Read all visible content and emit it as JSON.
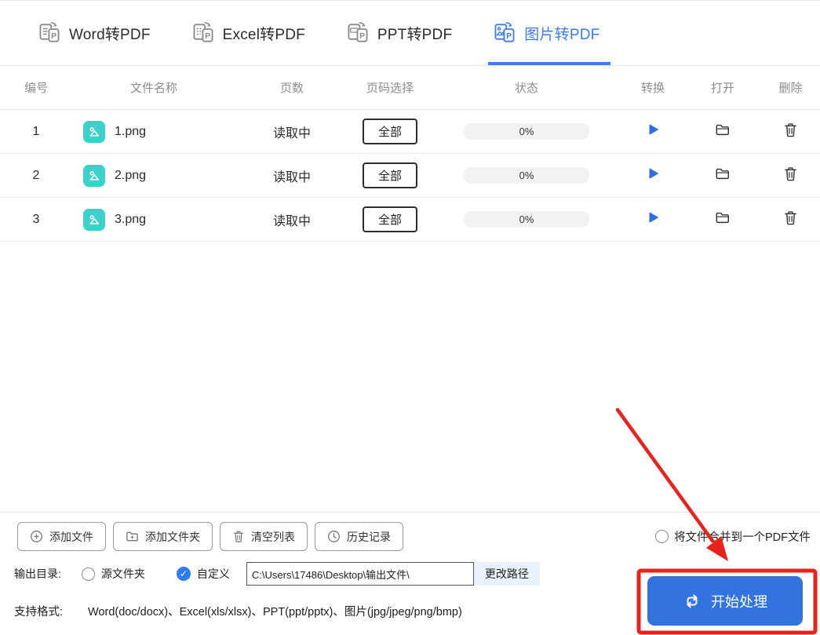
{
  "tabs": [
    {
      "label": "Word转PDF",
      "active": false
    },
    {
      "label": "Excel转PDF",
      "active": false
    },
    {
      "label": "PPT转PDF",
      "active": false
    },
    {
      "label": "图片转PDF",
      "active": true
    }
  ],
  "table": {
    "headers": [
      "编号",
      "文件名称",
      "页数",
      "页码选择",
      "状态",
      "转换",
      "打开",
      "删除"
    ],
    "rows": [
      {
        "index": "1",
        "filename": "1.png",
        "pages": "读取中",
        "page_select": "全部",
        "progress": "0%"
      },
      {
        "index": "2",
        "filename": "2.png",
        "pages": "读取中",
        "page_select": "全部",
        "progress": "0%"
      },
      {
        "index": "3",
        "filename": "3.png",
        "pages": "读取中",
        "page_select": "全部",
        "progress": "0%"
      }
    ]
  },
  "actions": {
    "add_file": "添加文件",
    "add_folder": "添加文件夹",
    "clear_list": "清空列表",
    "history": "历史记录"
  },
  "merge_option": {
    "label": "将文件合并到一个PDF文件",
    "checked": false
  },
  "output": {
    "label": "输出目录:",
    "source_folder": "源文件夹",
    "custom": "自定义",
    "path": "C:\\Users\\17486\\Desktop\\输出文件\\",
    "change_path": "更改路径"
  },
  "formats": {
    "label": "支持格式:",
    "value": "Word(doc/docx)、Excel(xls/xlsx)、PPT(ppt/pptx)、图片(jpg/jpeg/png/bmp)"
  },
  "start_button": {
    "label": "开始处理"
  },
  "glyphs": {
    "check": "✓"
  },
  "icons": {
    "tab": "document-to-pdf",
    "file": "image-file",
    "convert": "play",
    "open": "folder",
    "delete": "trash",
    "add_file": "circle-plus",
    "add_folder": "folder-plus",
    "clear": "trash",
    "history": "clock",
    "start": "repeat-loop"
  },
  "colors": {
    "accent_blue": "#3b7cf2",
    "start_button_blue": "#3373e0",
    "file_badge_teal": "#3bd2cc",
    "annotation_red": "#e8231d",
    "progress_bg": "#f2f2f2"
  }
}
